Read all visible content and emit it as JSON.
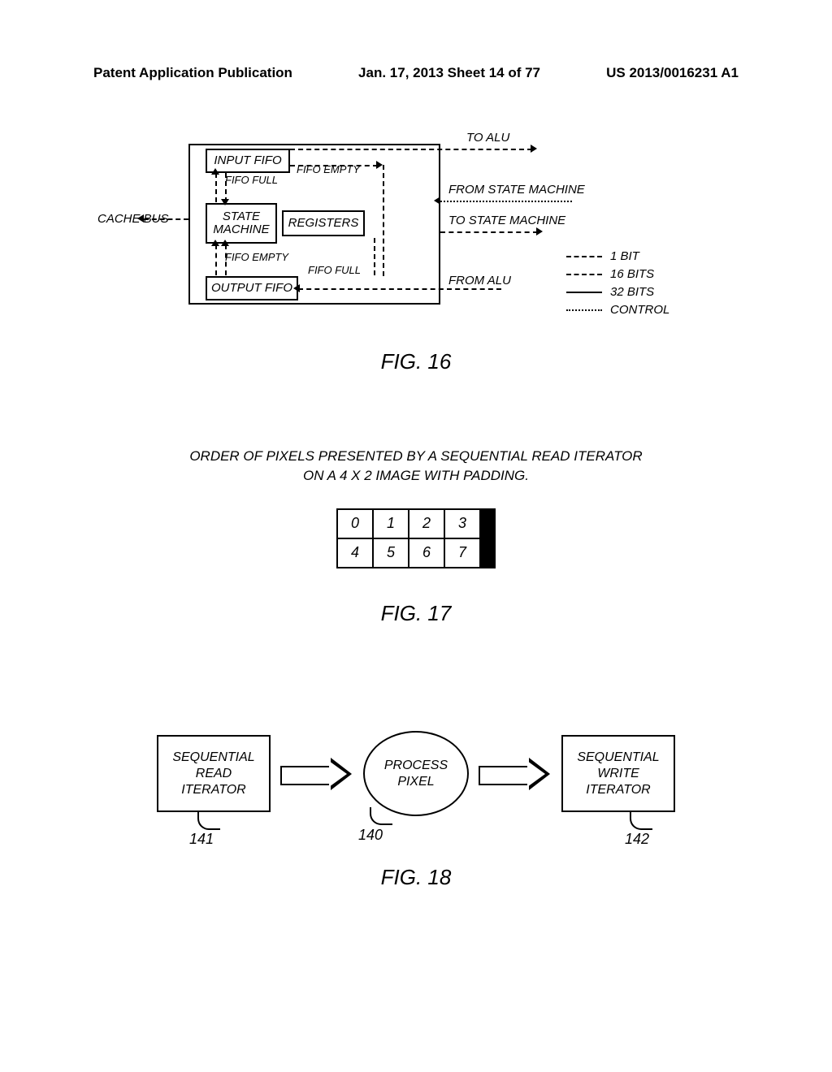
{
  "header": {
    "left": "Patent Application Publication",
    "mid": "Jan. 17, 2013  Sheet 14 of 77",
    "right": "US 2013/0016231 A1"
  },
  "fig16": {
    "cache_bus": "CACHE BUS",
    "input_fifo": "INPUT FIFO",
    "output_fifo": "OUTPUT FIFO",
    "state_machine": "STATE\nMACHINE",
    "registers": "REGISTERS",
    "fifo_full_top": "FIFO FULL",
    "fifo_empty_top": "FIFO EMPTY",
    "fifo_empty_bot": "FIFO EMPTY",
    "fifo_full_bot": "FIFO FULL",
    "to_alu": "TO ALU",
    "from_alu": "FROM ALU",
    "from_sm": "FROM STATE MACHINE",
    "to_sm": "TO STATE MACHINE",
    "legend": {
      "l1": "1 BIT",
      "l2": "16 BITS",
      "l3": "32 BITS",
      "l4": "CONTROL"
    },
    "caption": "FIG. 16"
  },
  "fig17": {
    "title_line1": "ORDER OF PIXELS PRESENTED BY A SEQUENTIAL READ ITERATOR",
    "title_line2": "ON A 4 X 2 IMAGE WITH PADDING.",
    "cells": [
      "0",
      "1",
      "2",
      "3",
      "4",
      "5",
      "6",
      "7"
    ],
    "caption": "FIG. 17"
  },
  "fig18": {
    "read_iterator": "SEQUENTIAL\nREAD\nITERATOR",
    "process": "PROCESS\nPIXEL",
    "write_iterator": "SEQUENTIAL\nWRITE\nITERATOR",
    "ref_left": "141",
    "ref_mid": "140",
    "ref_right": "142",
    "caption": "FIG. 18"
  }
}
